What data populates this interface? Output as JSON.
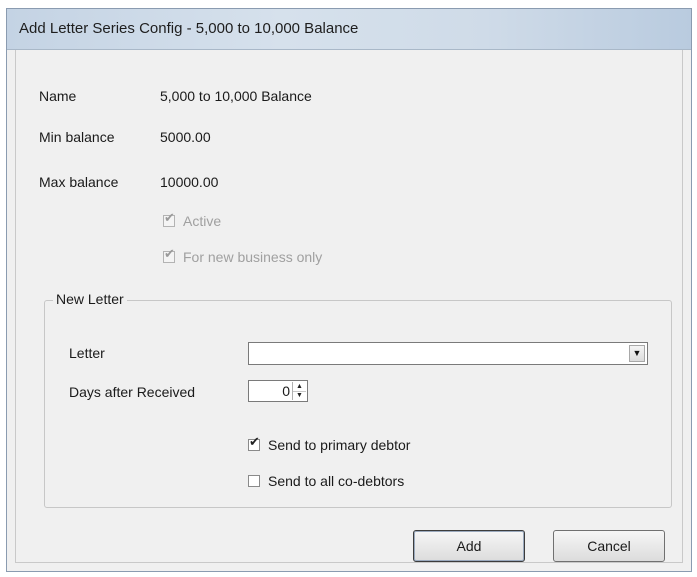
{
  "window": {
    "title": "Add Letter Series Config - 5,000 to 10,000 Balance"
  },
  "fields": {
    "name_label": "Name",
    "name_value": "5,000 to 10,000 Balance",
    "min_label": "Min balance",
    "min_value": "5000.00",
    "max_label": "Max balance",
    "max_value": "10000.00"
  },
  "options": {
    "active_label": "Active",
    "active_checked": true,
    "new_business_label": "For new business only",
    "new_business_checked": true
  },
  "new_letter": {
    "group_title": "New Letter",
    "letter_label": "Letter",
    "letter_value": "",
    "days_label": "Days after Received",
    "days_value": "0",
    "primary_label": "Send to primary debtor",
    "primary_checked": true,
    "codebtors_label": "Send to all co-debtors",
    "codebtors_checked": false
  },
  "buttons": {
    "add_label": "Add",
    "cancel_label": "Cancel"
  }
}
